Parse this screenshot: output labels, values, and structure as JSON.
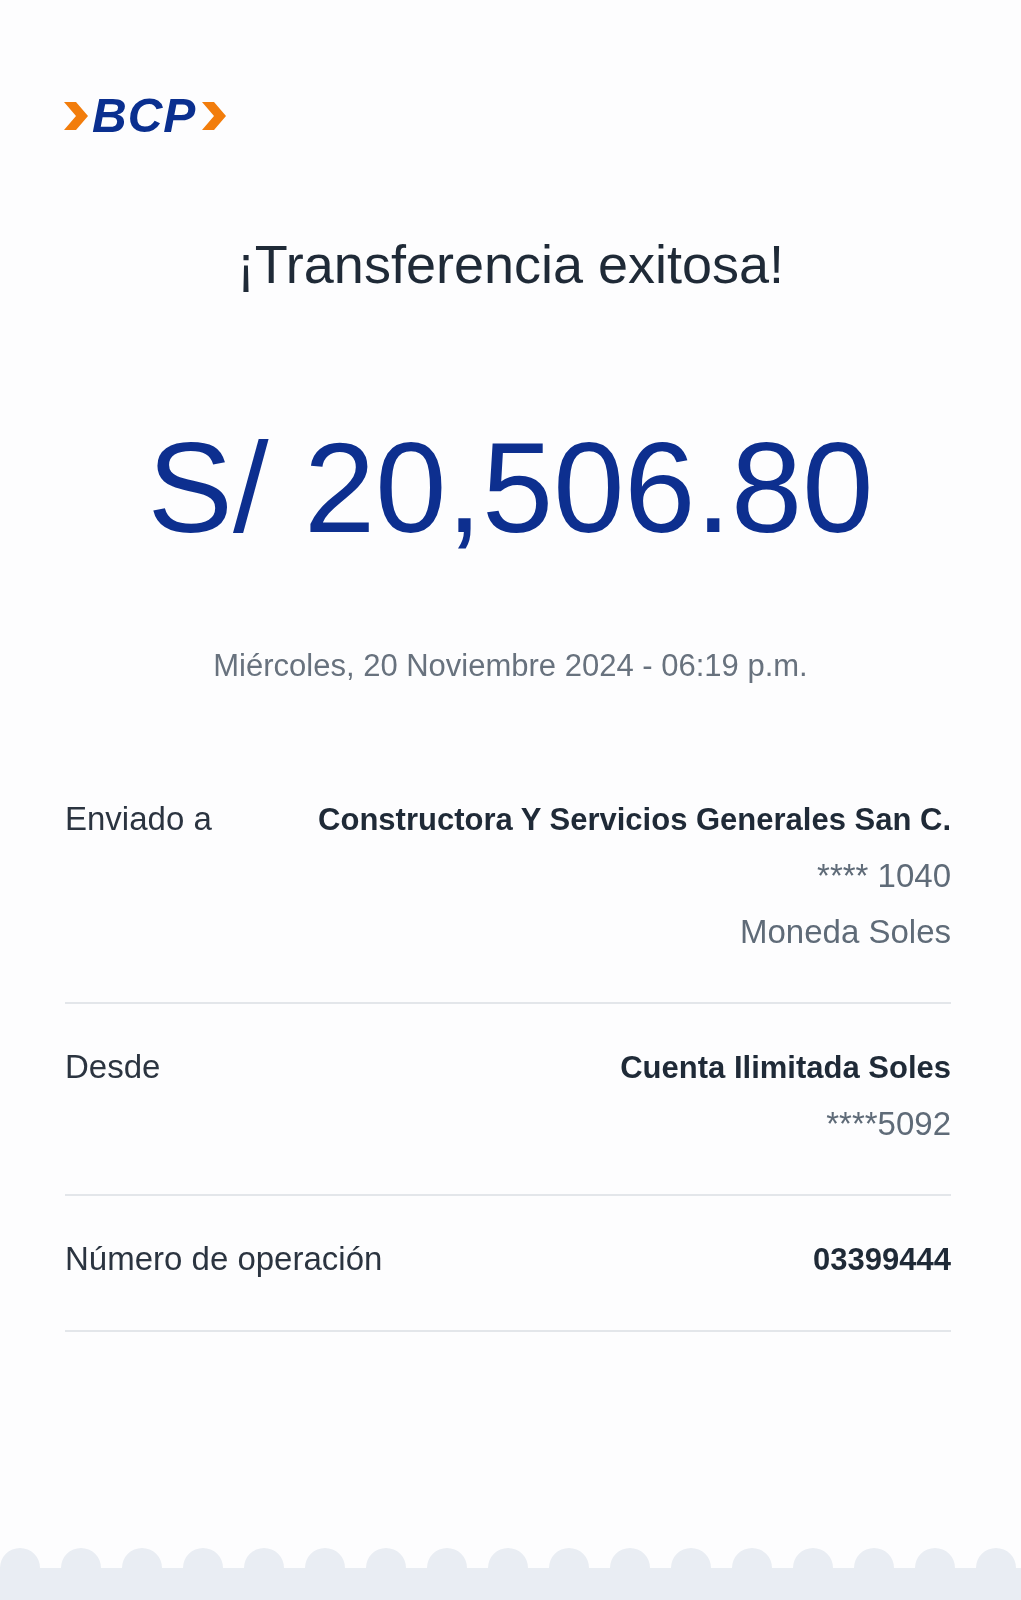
{
  "logo": {
    "text": "BCP"
  },
  "title": "¡Transferencia exitosa!",
  "amount": "S/ 20,506.80",
  "datetime": "Miércoles, 20 Noviembre 2024 - 06:19 p.m.",
  "details": [
    {
      "label": "Enviado a",
      "value": "Constructora Y Servicios Generales San C.",
      "extra": [
        "**** 1040",
        "Moneda Soles"
      ]
    },
    {
      "label": "Desde",
      "value": "Cuenta Ilimitada Soles",
      "extra": [
        "****5092"
      ]
    },
    {
      "label": "Número de operación",
      "value": "03399444"
    }
  ]
}
